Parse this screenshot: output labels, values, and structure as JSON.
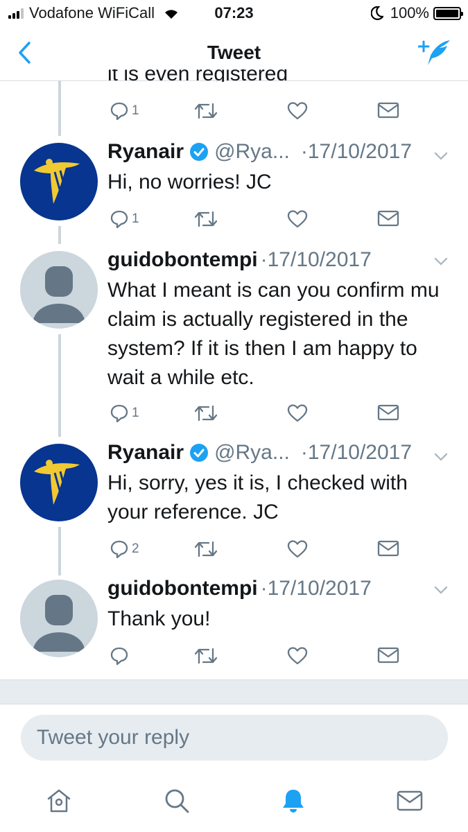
{
  "status_bar": {
    "carrier": "Vodafone WiFiCall",
    "time": "07:23",
    "battery": "100%",
    "icons": [
      "signal-icon",
      "wifi-icon",
      "moon-icon",
      "battery-icon"
    ]
  },
  "nav": {
    "title": "Tweet",
    "icons": [
      "back-chevron-icon",
      "compose-tweet-icon"
    ]
  },
  "thread": {
    "clipped_text": "it is even  registered",
    "clipped_reply_count": "1",
    "tweets": [
      {
        "name": "Ryanair",
        "verified": true,
        "handle": "@Rya...",
        "date": "·17/10/2017",
        "text": "Hi, no worries! JC",
        "reply_count": "1"
      },
      {
        "name": "guidobontempi",
        "verified": false,
        "handle": "",
        "date": "·17/10/2017",
        "text": "What I meant is can you confirm mu claim is actually registered in the system?  If it is then I am happy to wait a while etc.",
        "reply_count": "1"
      },
      {
        "name": "Ryanair",
        "verified": true,
        "handle": "@Rya...",
        "date": "·17/10/2017",
        "text": "Hi, sorry, yes it is, I checked with your reference. JC",
        "reply_count": "2"
      },
      {
        "name": "guidobontempi",
        "verified": false,
        "handle": "",
        "date": "·17/10/2017",
        "text": "Thank you!",
        "reply_count": ""
      }
    ]
  },
  "reply": {
    "placeholder": "Tweet your reply"
  },
  "tab_bar": {
    "tabs": [
      "home-icon",
      "search-icon",
      "notifications-icon",
      "messages-icon"
    ],
    "active": "notifications-icon"
  },
  "colors": {
    "accent": "#1da1f2",
    "icon_gray": "#657786",
    "ryanair_blue": "#073590",
    "ryanair_yellow": "#f1c933",
    "divider": "#e6ecf0"
  }
}
